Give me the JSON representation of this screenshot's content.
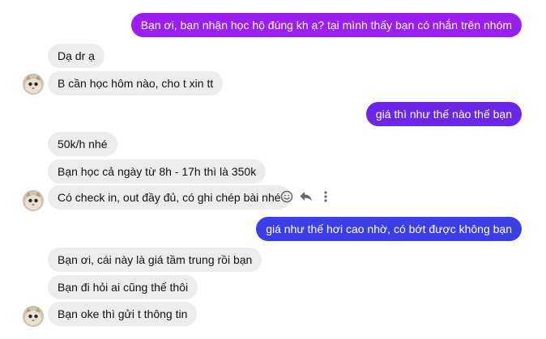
{
  "colors": {
    "outgoing_top": "#9b1ff0",
    "outgoing_mid": "#6a28e6",
    "outgoing_bottom": "#3d3fe6",
    "incoming_bg": "#ececec"
  },
  "messages": [
    {
      "id": "m1",
      "side": "out",
      "text": "Bạn ơi, bạn nhận học hộ đúng kh ạ? tại mình thấy bạn có nhắn trên nhóm"
    },
    {
      "id": "m2",
      "side": "in",
      "text": "Dạ dr ạ"
    },
    {
      "id": "m3",
      "side": "in",
      "text": "B cần học hôm nào, cho t xin tt"
    },
    {
      "id": "m4",
      "side": "out",
      "text": "giá thì như thế nào thế bạn"
    },
    {
      "id": "m5",
      "side": "in",
      "text": "50k/h nhé"
    },
    {
      "id": "m6",
      "side": "in",
      "text": "Bạn học cả ngày từ 8h - 17h thì là 350k"
    },
    {
      "id": "m7",
      "side": "in",
      "text": "Có check in, out đầy đủ, có ghi chép bài nhé"
    },
    {
      "id": "m8",
      "side": "out",
      "text": "giá như thế hơi cao nhờ, có bớt được không bạn"
    },
    {
      "id": "m9",
      "side": "in",
      "text": "Bạn ơi, cái này là giá tầm trung rồi bạn"
    },
    {
      "id": "m10",
      "side": "in",
      "text": "Bạn đi hỏi ai cũng thế thôi"
    },
    {
      "id": "m11",
      "side": "in",
      "text": "Bạn oke thì gửi t thông tin"
    }
  ],
  "message_actions": {
    "icons": [
      "smiley-icon",
      "reply-icon",
      "more-vertical-icon"
    ]
  }
}
